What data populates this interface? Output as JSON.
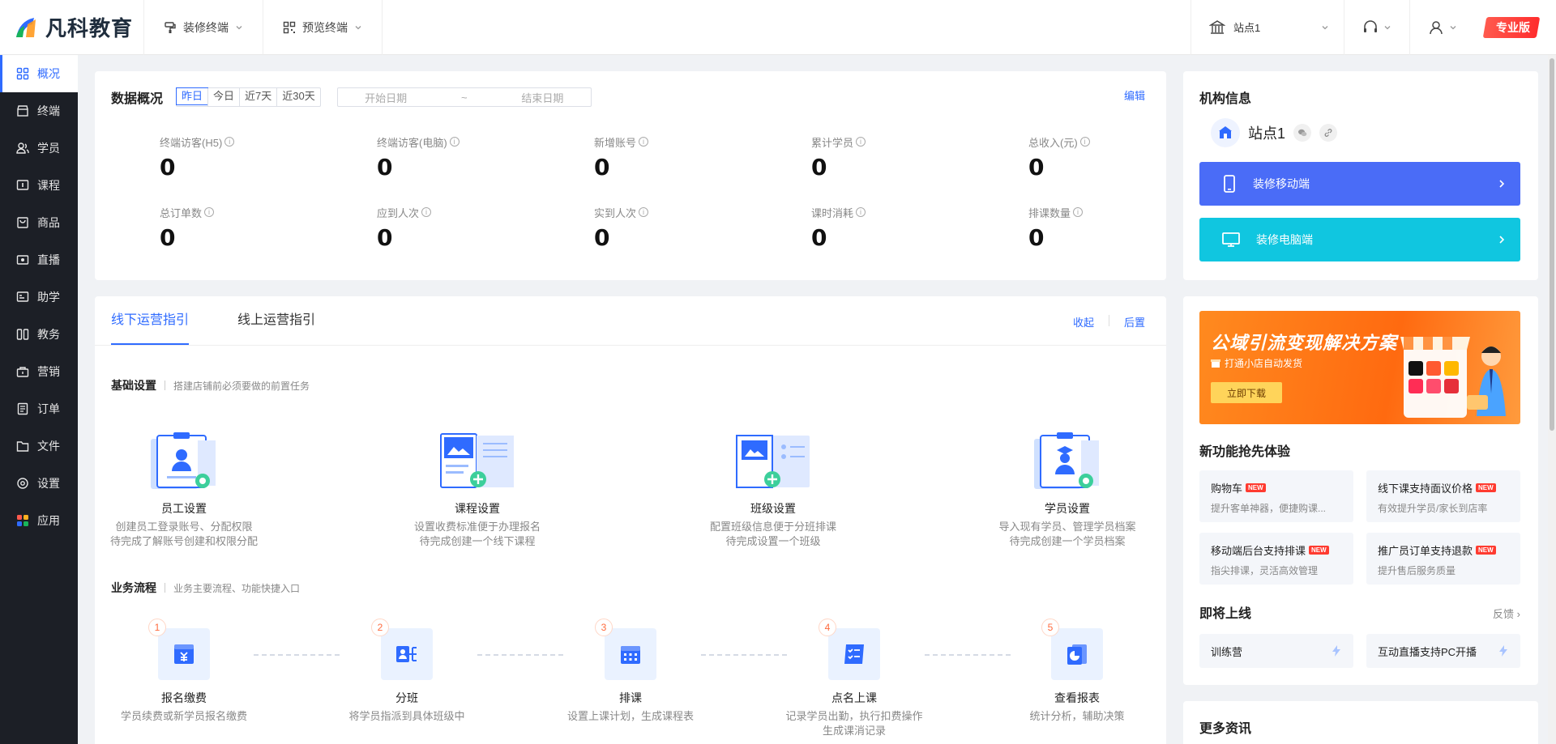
{
  "brand": {
    "name": "凡科教育"
  },
  "topbar": {
    "menus": [
      {
        "label": "装修终端"
      },
      {
        "label": "预览终端"
      }
    ],
    "site": "站点1",
    "pro": "专业版"
  },
  "sidebar": {
    "items": [
      {
        "label": "概况",
        "icon": "dashboard-icon"
      },
      {
        "label": "终端",
        "icon": "terminal-icon"
      },
      {
        "label": "学员",
        "icon": "students-icon"
      },
      {
        "label": "课程",
        "icon": "course-icon"
      },
      {
        "label": "商品",
        "icon": "goods-icon"
      },
      {
        "label": "直播",
        "icon": "live-icon"
      },
      {
        "label": "助学",
        "icon": "assist-icon"
      },
      {
        "label": "教务",
        "icon": "academic-icon"
      },
      {
        "label": "营销",
        "icon": "marketing-icon"
      },
      {
        "label": "订单",
        "icon": "order-icon"
      },
      {
        "label": "文件",
        "icon": "folder-icon"
      },
      {
        "label": "设置",
        "icon": "settings-icon"
      },
      {
        "label": "应用",
        "icon": "apps-icon"
      }
    ]
  },
  "overview": {
    "title": "数据概况",
    "ranges": [
      "昨日",
      "今日",
      "近7天",
      "近30天"
    ],
    "start_placeholder": "开始日期",
    "range_sep": "~",
    "end_placeholder": "结束日期",
    "edit": "编辑",
    "stats": [
      {
        "label": "终端访客(H5)",
        "value": "0"
      },
      {
        "label": "终端访客(电脑)",
        "value": "0"
      },
      {
        "label": "新增账号",
        "value": "0"
      },
      {
        "label": "累计学员",
        "value": "0"
      },
      {
        "label": "总收入(元)",
        "value": "0"
      },
      {
        "label": "总订单数",
        "value": "0"
      },
      {
        "label": "应到人次",
        "value": "0"
      },
      {
        "label": "实到人次",
        "value": "0"
      },
      {
        "label": "课时消耗",
        "value": "0"
      },
      {
        "label": "排课数量",
        "value": "0"
      }
    ]
  },
  "guide": {
    "tabs": [
      "线下运营指引",
      "线上运营指引"
    ],
    "collapse": "收起",
    "postpone": "后置",
    "basic": {
      "title": "基础设置",
      "desc": "搭建店铺前必须要做的前置任务"
    },
    "setup": [
      {
        "name": "员工设置",
        "desc1": "创建员工登录账号、分配权限",
        "desc2": "待完成了解账号创建和权限分配"
      },
      {
        "name": "课程设置",
        "desc1": "设置收费标准便于办理报名",
        "desc2": "待完成创建一个线下课程"
      },
      {
        "name": "班级设置",
        "desc1": "配置班级信息便于分班排课",
        "desc2": "待完成设置一个班级"
      },
      {
        "name": "学员设置",
        "desc1": "导入现有学员、管理学员档案",
        "desc2": "待完成创建一个学员档案"
      }
    ],
    "flow_title": {
      "title": "业务流程",
      "desc": "业务主要流程、功能快捷入口"
    },
    "flow": [
      {
        "num": "1",
        "name": "报名缴费",
        "desc1": "学员续费或新学员报名缴费",
        "desc2": ""
      },
      {
        "num": "2",
        "name": "分班",
        "desc1": "将学员指派到具体班级中",
        "desc2": ""
      },
      {
        "num": "3",
        "name": "排课",
        "desc1": "设置上课计划，生成课程表",
        "desc2": ""
      },
      {
        "num": "4",
        "name": "点名上课",
        "desc1": "记录学员出勤，执行扣费操作",
        "desc2": "生成课消记录"
      },
      {
        "num": "5",
        "name": "查看报表",
        "desc1": "统计分析，辅助决策",
        "desc2": ""
      }
    ]
  },
  "org": {
    "title": "机构信息",
    "name": "站点1",
    "mobile_btn": "装修移动端",
    "pc_btn": "装修电脑端"
  },
  "banner": {
    "title": "公域引流变现解决方案",
    "sub": "打通小店自动发货",
    "button": "立即下载"
  },
  "features": {
    "title": "新功能抢先体验",
    "items": [
      {
        "title": "购物车",
        "badge": "NEW",
        "desc": "提升客单神器，便捷购课..."
      },
      {
        "title": "线下课支持面议价格",
        "badge": "NEW",
        "desc": "有效提升学员/家长到店率"
      },
      {
        "title": "移动端后台支持排课",
        "badge": "NEW",
        "desc": "指尖排课，灵活高效管理"
      },
      {
        "title": "推广员订单支持退款",
        "badge": "NEW",
        "desc": "提升售后服务质量"
      }
    ]
  },
  "coming": {
    "title": "即将上线",
    "feedback": "反馈",
    "items": [
      "训练营",
      "互动直播支持PC开播"
    ]
  },
  "more": {
    "title": "更多资讯"
  },
  "colors": {
    "accent": "#2f6bff",
    "sidebar": "#1c1f26",
    "mobile_btn": "#4a6cf7",
    "pc_btn": "#10c6e0",
    "banner": "#ff7a1a"
  }
}
